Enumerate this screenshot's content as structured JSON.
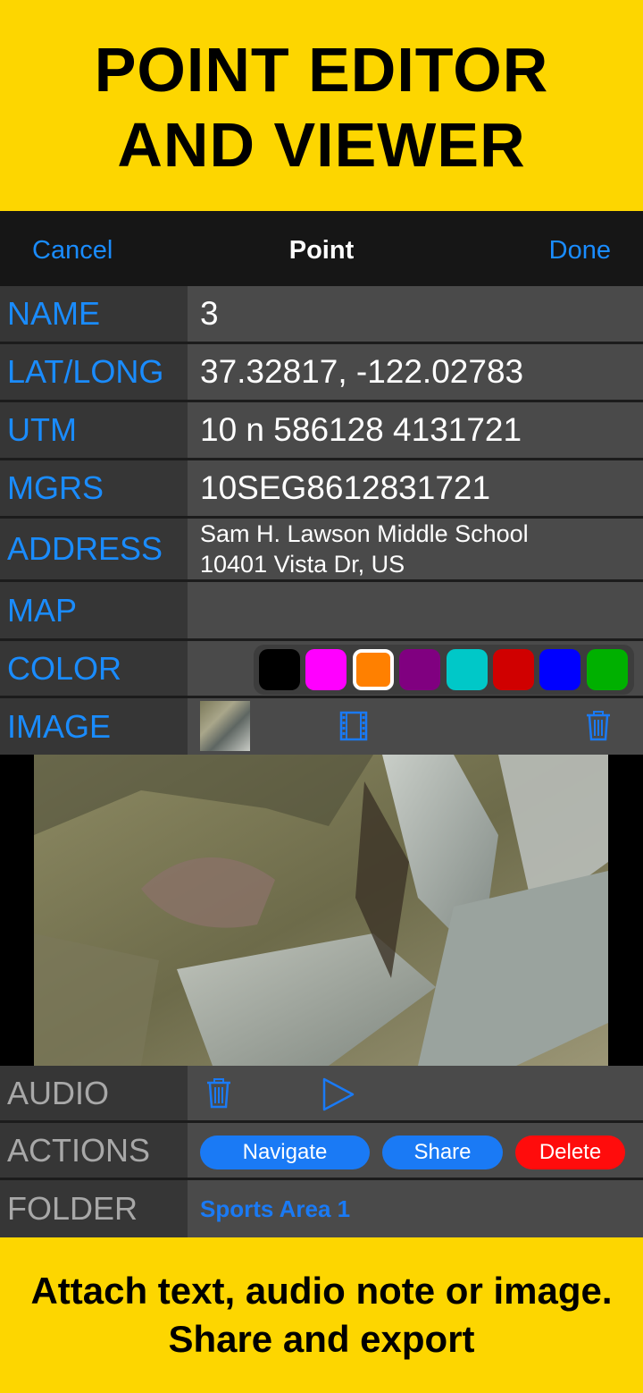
{
  "banner_top": {
    "line1": "POINT EDITOR",
    "line2": "AND VIEWER"
  },
  "navbar": {
    "cancel": "Cancel",
    "title": "Point",
    "done": "Done"
  },
  "fields": {
    "name": {
      "label": "NAME",
      "value": "3"
    },
    "latlong": {
      "label": "LAT/LONG",
      "value": "37.32817, -122.02783"
    },
    "utm": {
      "label": "UTM",
      "value": "10 n 586128 4131721"
    },
    "mgrs": {
      "label": "MGRS",
      "value": "10SEG8612831721"
    },
    "address": {
      "label": "ADDRESS",
      "line1": "Sam H. Lawson Middle School",
      "line2": "10401 Vista Dr, US"
    },
    "map": {
      "label": "MAP"
    },
    "color": {
      "label": "COLOR",
      "swatches": [
        "#000000",
        "#ff00ff",
        "#ff8000",
        "#800080",
        "#00c8c8",
        "#d00000",
        "#0000ff",
        "#00b000"
      ],
      "selected": "#ff8000"
    },
    "image": {
      "label": "IMAGE"
    },
    "audio": {
      "label": "AUDIO"
    },
    "actions": {
      "label": "ACTIONS",
      "navigate": "Navigate",
      "share": "Share",
      "delete": "Delete"
    },
    "folder": {
      "label": "FOLDER",
      "value": "Sports Area 1"
    }
  },
  "icons": {
    "film": "film-icon",
    "trash": "trash-icon",
    "play": "play-icon"
  },
  "colors": {
    "accent": "#1a8cff",
    "banner": "#FDD600",
    "delete": "#ff0c0c"
  },
  "banner_bottom": {
    "line1": "Attach text, audio note or image.",
    "line2": "Share and export"
  }
}
